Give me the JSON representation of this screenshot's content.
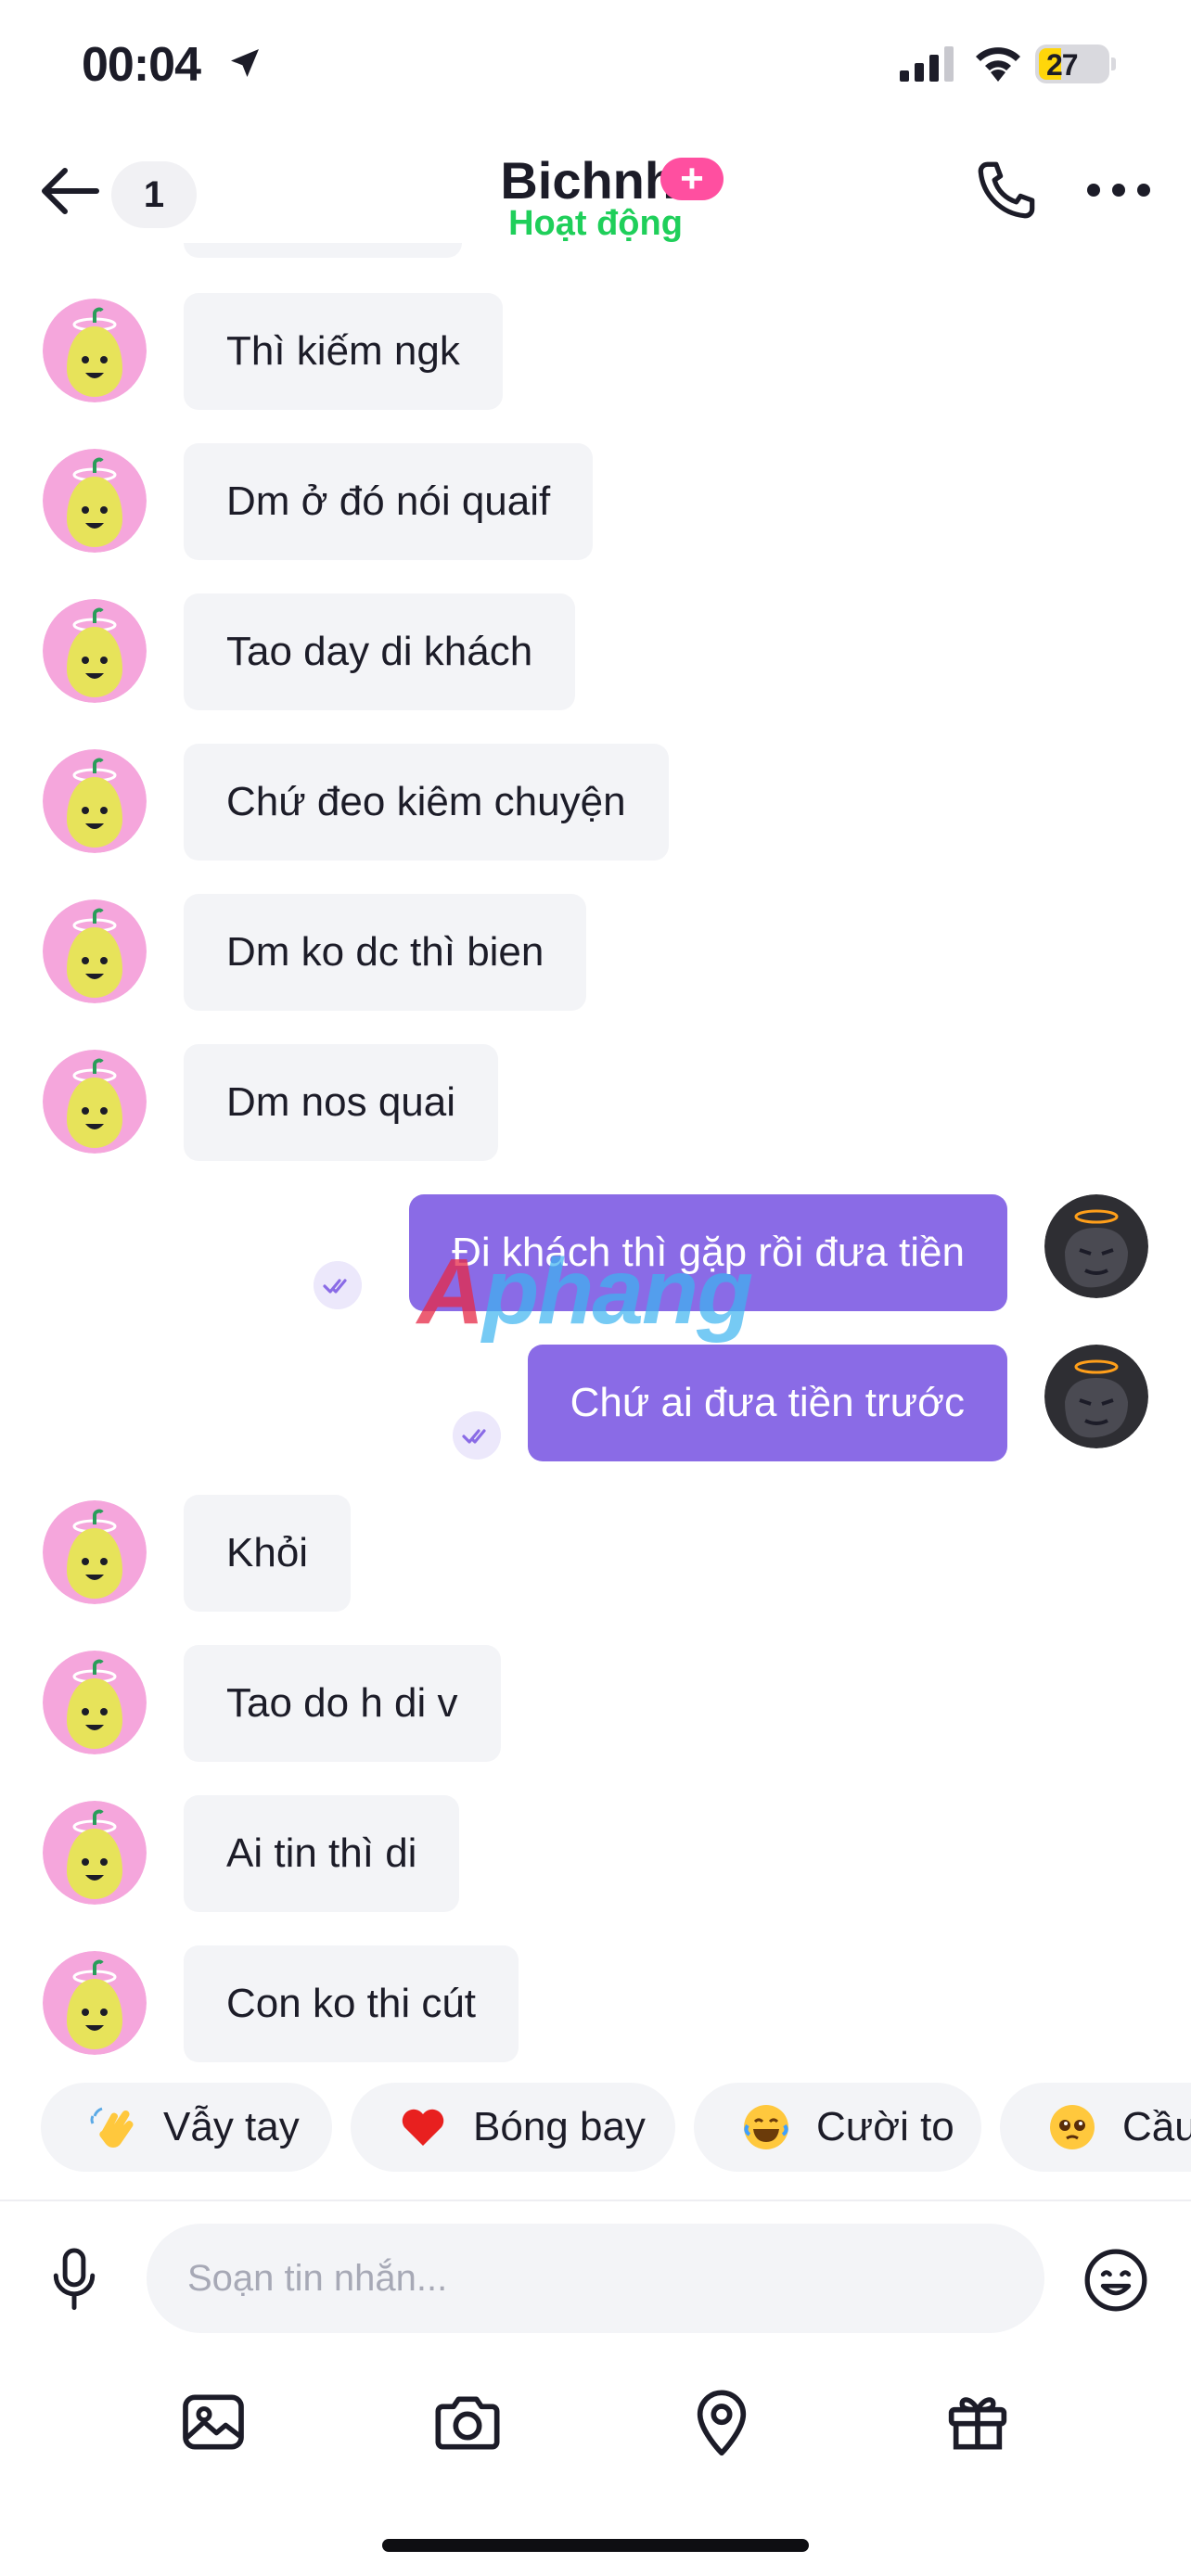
{
  "status_bar": {
    "time": "00:04",
    "battery": "27"
  },
  "header": {
    "unread_count": "1",
    "contact_name": "Bichnhi",
    "plus_badge": "+",
    "presence": "Hoạt động"
  },
  "messages": [
    {
      "direction": "in",
      "text": "Thì kiếm ngk"
    },
    {
      "direction": "in",
      "text": "Dm ở đó nói quaif"
    },
    {
      "direction": "in",
      "text": "Tao day di khách"
    },
    {
      "direction": "in",
      "text": "Chứ đeo kiêm chuyện"
    },
    {
      "direction": "in",
      "text": "Dm ko dc thì bien"
    },
    {
      "direction": "in",
      "text": "Dm nos quai"
    },
    {
      "direction": "out",
      "text": "Đi khách thì gặp rồi đưa tiền"
    },
    {
      "direction": "out",
      "text": "Chứ ai đưa tiền trước"
    },
    {
      "direction": "in",
      "text": "Khỏi"
    },
    {
      "direction": "in",
      "text": "Tao do h di v"
    },
    {
      "direction": "in",
      "text": "Ai tin thì di"
    },
    {
      "direction": "in",
      "text": "Con ko thi cút"
    }
  ],
  "watermark": {
    "part1": "A",
    "part2": "phang"
  },
  "reactions": [
    {
      "icon": "waving-hand-icon",
      "label": "Vẫy tay"
    },
    {
      "icon": "red-heart-icon",
      "label": "Bóng bay"
    },
    {
      "icon": "laughing-tears-icon",
      "label": "Cười to"
    },
    {
      "icon": "pleading-face-icon",
      "label": "Cầu"
    }
  ],
  "composer": {
    "placeholder": "Soạn tin nhắn..."
  },
  "colors": {
    "outgoing_bubble": "#8a6be6",
    "incoming_bubble": "#f3f4f7",
    "presence": "#1fcf5a",
    "plus_badge": "#ff4fa0"
  }
}
